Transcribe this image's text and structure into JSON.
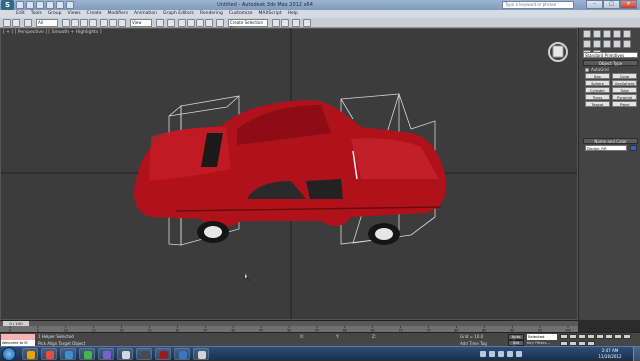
{
  "window": {
    "title": "Untitled - Autodesk 3ds Max 2012 x64",
    "help_search_placeholder": "Type a keyword or phrase",
    "minimize": "–",
    "maximize": "□",
    "close": "✕"
  },
  "app_logo": "S",
  "menubar": {
    "items": [
      "Edit",
      "Tools",
      "Group",
      "Views",
      "Create",
      "Modifiers",
      "Animation",
      "Graph Editors",
      "Rendering",
      "Customize",
      "MAXScript",
      "Help"
    ]
  },
  "main_toolbar": {
    "undo_count": "",
    "selection_filter": "All",
    "reference_coord": "View",
    "named_selection": "Create Selection Se"
  },
  "viewport": {
    "label": "[ + ] [ Perspective ] [ Smooth + Highlights ]"
  },
  "command_panel": {
    "dropdown": "Standard Primitives",
    "object_type_title": "Object Type",
    "autogrid_label": "AutoGrid",
    "objects": [
      "Box",
      "Cone",
      "Sphere",
      "GeoSphere",
      "Cylinder",
      "Tube",
      "Torus",
      "Pyramid",
      "Teapot",
      "Plane"
    ],
    "name_color_title": "Name and Color",
    "name_value": "Dodge_RR",
    "object_color": "#1e6ad8"
  },
  "timeline": {
    "slider_text": "0 / 100",
    "ticks": [
      "0",
      "5",
      "10",
      "15",
      "20",
      "25",
      "30",
      "35",
      "40",
      "45",
      "50",
      "55",
      "60",
      "65",
      "70",
      "75",
      "80",
      "85",
      "90",
      "95",
      "100"
    ]
  },
  "statusbar": {
    "listener_text": "Welcome to M",
    "selection": "1 Helper Selected",
    "prompt": "Pick Align Target Object",
    "x": "X:",
    "y": "Y:",
    "z": "Z:",
    "grid": "Grid = 10.0",
    "add_time_tag": "Add Time Tag",
    "auto_key": "Auto Key",
    "set_key": "Set Key",
    "selected_dropdown": "Selected",
    "key_filters": "Key Filters..."
  },
  "taskbar": {
    "clock_time": "2:47 AM",
    "clock_date": "11/26/2012",
    "app_colors": [
      "#f0a300",
      "#e74c3c",
      "#3d8fd6",
      "#45b649",
      "#7a5fd3",
      "#cfd8e3",
      "#4a4a4a",
      "#9b1b1b",
      "#3a76c4",
      "#d4d4d4"
    ]
  },
  "colors": {
    "viewport_bg": "#3c3c3c",
    "car_body": "#b0121c",
    "gizmo": "#d9d9d9"
  }
}
